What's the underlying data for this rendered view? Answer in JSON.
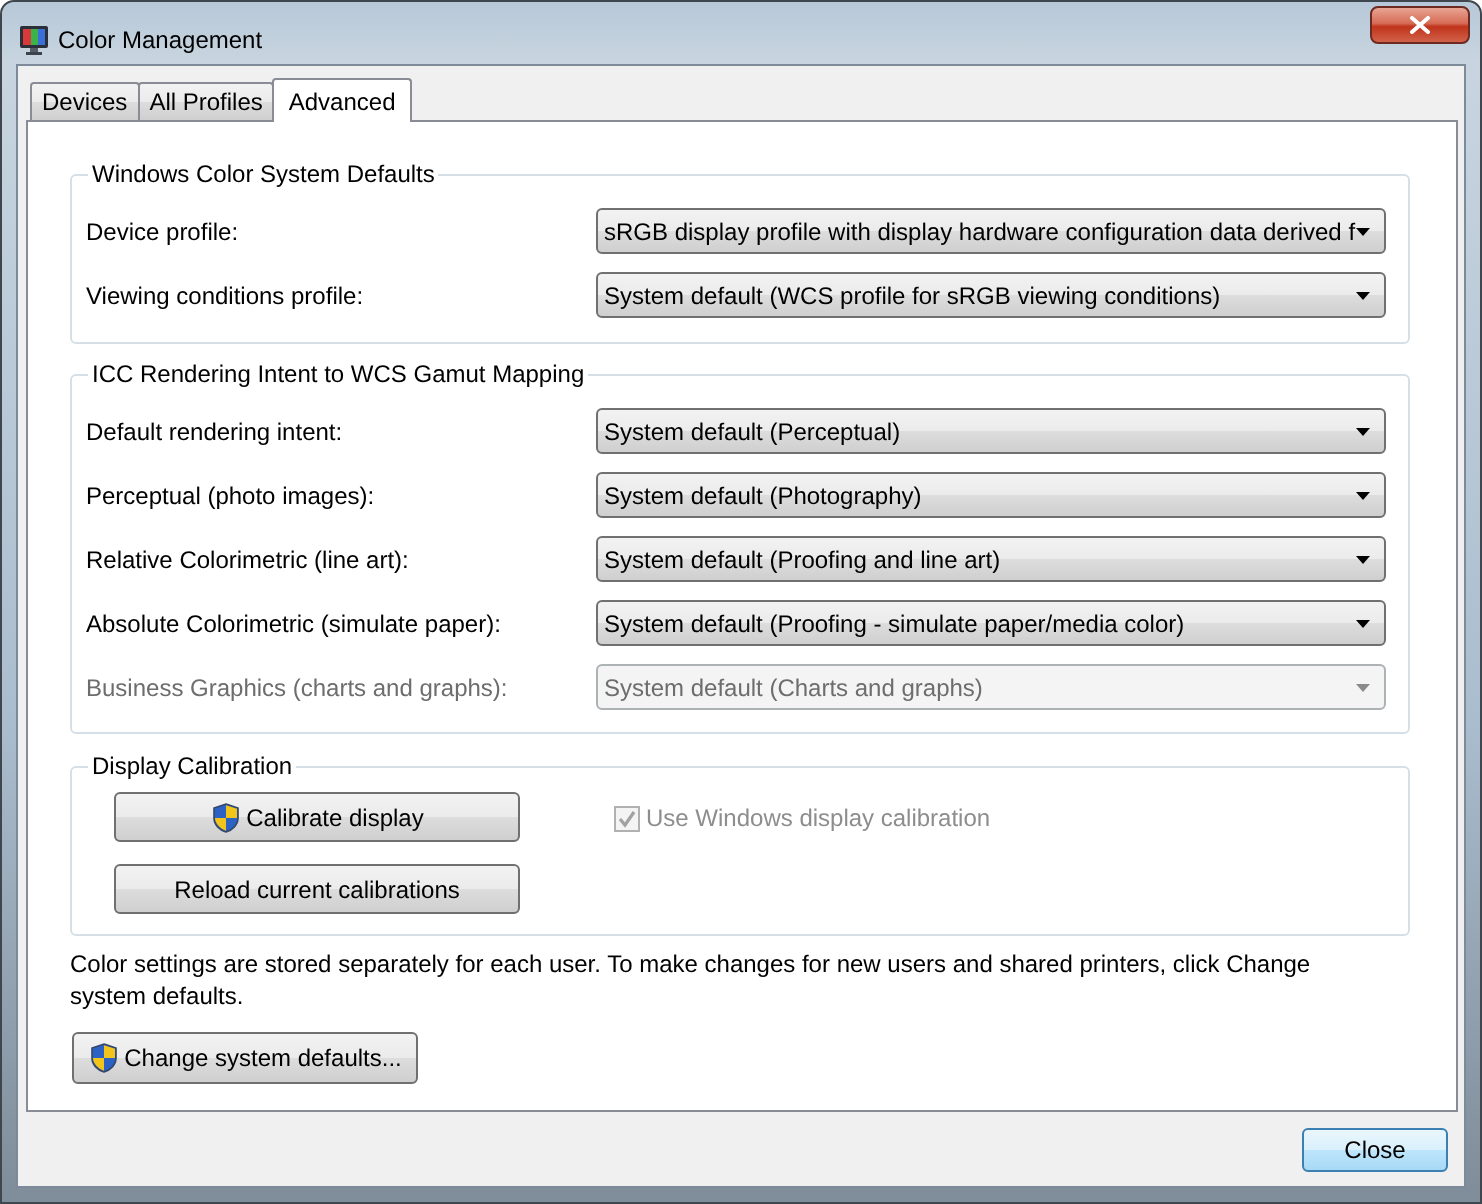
{
  "window": {
    "title": "Color Management"
  },
  "tabs": [
    {
      "label": "Devices",
      "selected": false
    },
    {
      "label": "All Profiles",
      "selected": false
    },
    {
      "label": "Advanced",
      "selected": true
    }
  ],
  "groups": [
    {
      "title": "Windows Color System Defaults",
      "rows": [
        {
          "label": "Device profile:",
          "value": "sRGB display profile with display hardware configuration data derived f",
          "disabled": false
        },
        {
          "label": "Viewing conditions profile:",
          "value": "System default (WCS profile for sRGB viewing conditions)",
          "disabled": false
        }
      ]
    },
    {
      "title": "ICC Rendering Intent to WCS Gamut Mapping",
      "rows": [
        {
          "label": "Default rendering intent:",
          "value": "System default (Perceptual)",
          "disabled": false
        },
        {
          "label": "Perceptual (photo images):",
          "value": "System default (Photography)",
          "disabled": false
        },
        {
          "label": "Relative Colorimetric (line art):",
          "value": "System default (Proofing and line art)",
          "disabled": false
        },
        {
          "label": "Absolute Colorimetric (simulate paper):",
          "value": "System default (Proofing - simulate paper/media color)",
          "disabled": false
        },
        {
          "label": "Business Graphics (charts and graphs):",
          "value": "System default (Charts and graphs)",
          "disabled": true
        }
      ]
    }
  ],
  "calibration": {
    "title": "Display Calibration",
    "buttons": [
      {
        "label": "Calibrate display",
        "elevated": true
      },
      {
        "label": "Reload current calibrations",
        "elevated": false
      }
    ],
    "checkbox": {
      "label": "Use Windows display calibration",
      "checked": true,
      "disabled": true
    }
  },
  "note": "Color settings are stored separately for each user. To make changes for new users and shared printers, click Change system defaults.",
  "change_button": {
    "label": "Change system defaults...",
    "elevated": true
  },
  "close_button": {
    "label": "Close",
    "default": true
  }
}
